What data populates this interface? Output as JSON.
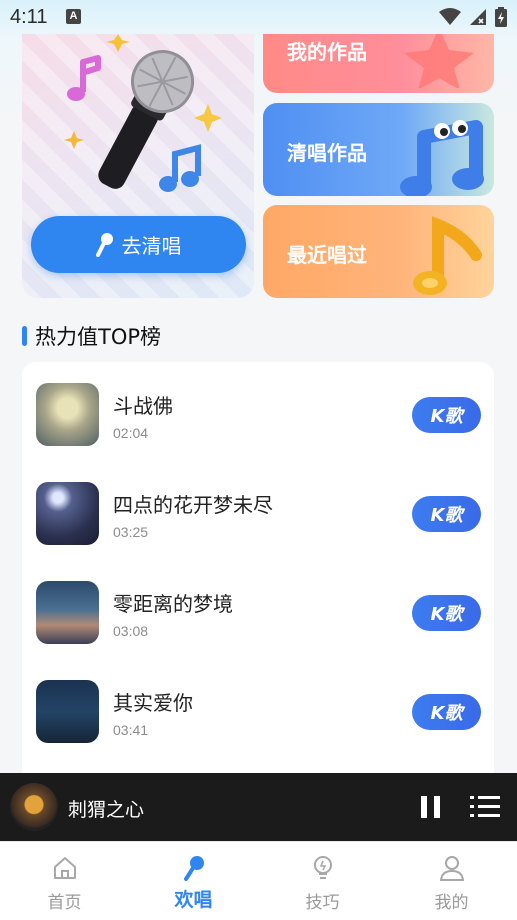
{
  "status_bar": {
    "time": "4:11",
    "badge": "A"
  },
  "cards": {
    "go_sing_label": "去清唱",
    "my_works": "我的作品",
    "clean_works": "清唱作品",
    "recently_sung": "最近唱过"
  },
  "section": {
    "title": "热力值TOP榜"
  },
  "songs": [
    {
      "title": "斗战佛",
      "duration": "02:04",
      "action": "K歌"
    },
    {
      "title": "四点的花开梦未尽",
      "duration": "03:25",
      "action": "K歌"
    },
    {
      "title": "零距离的梦境",
      "duration": "03:08",
      "action": "K歌"
    },
    {
      "title": "其实爱你",
      "duration": "03:41",
      "action": "K歌"
    }
  ],
  "player": {
    "now_playing": "刺猬之心",
    "state": "playing"
  },
  "tabs": [
    {
      "label": "首页",
      "icon": "home-icon",
      "active": false
    },
    {
      "label": "欢唱",
      "icon": "microphone-icon",
      "active": true
    },
    {
      "label": "技巧",
      "icon": "lightbulb-icon",
      "active": false
    },
    {
      "label": "我的",
      "icon": "user-icon",
      "active": false
    }
  ],
  "colors": {
    "accent": "#2f86f0",
    "k_button": "#3a6ae8",
    "player_bg": "#1b1b1b"
  }
}
